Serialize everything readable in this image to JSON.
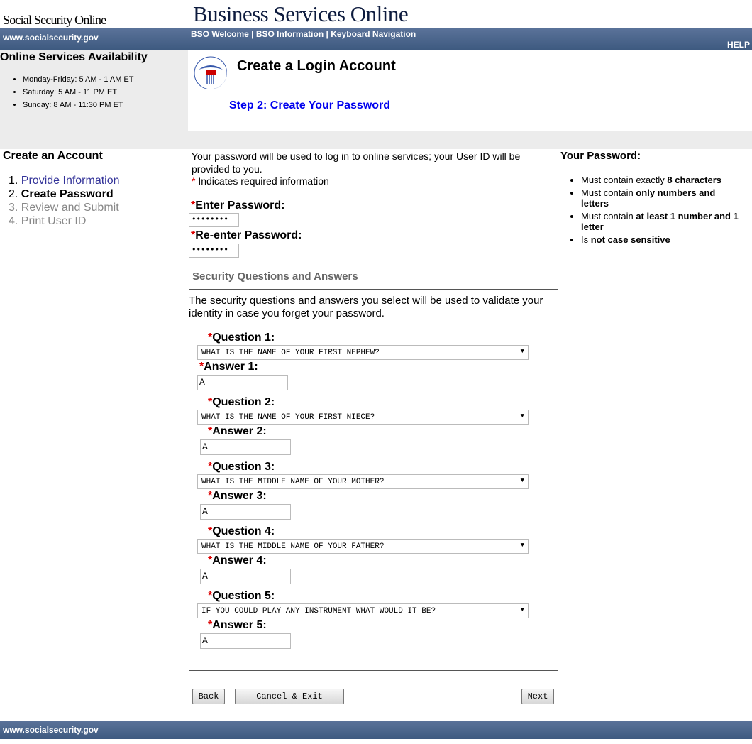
{
  "header": {
    "site_name": "Social Security Online",
    "app_title": "Business Services Online",
    "site_url": "www.socialsecurity.gov",
    "nav": [
      "BSO Welcome",
      "BSO Information",
      "Keyboard Navigation"
    ],
    "help": "HELP"
  },
  "availability": {
    "title": "Online Services Availability",
    "items": [
      "Monday-Friday: 5 AM - 1 AM ET",
      "Saturday: 5 AM - 11 PM ET",
      "Sunday: 8 AM - 11:30 PM ET"
    ]
  },
  "page": {
    "title": "Create a Login Account",
    "step": "Step 2: Create Your Password",
    "seal_text": "SOCIAL SECURITY ADMINISTRATION USA"
  },
  "sidebar": {
    "title": "Create an Account",
    "steps": [
      {
        "num": "1.",
        "label": "Provide Information"
      },
      {
        "num": "2.",
        "label": "Create Password"
      },
      {
        "num": "3.",
        "label": "Review and Submit"
      },
      {
        "num": "4.",
        "label": "Print User ID"
      }
    ]
  },
  "main": {
    "intro": "Your password will be used to log in to online services; your User ID will be provided to you.",
    "required_note": "Indicates required information",
    "required_mark": "*",
    "password_label": "Enter Password:",
    "password_value": "••••••••",
    "reenter_label": "Re-enter Password:",
    "reenter_value": "••••••••",
    "security_heading": "Security Questions and Answers",
    "security_intro": "The security questions and answers you select will be used to validate your identity in case you forget your password.",
    "questions": [
      {
        "q_label": "Question 1:",
        "q_value": "WHAT IS THE NAME OF YOUR FIRST NEPHEW?",
        "a_label": "Answer 1:",
        "a_value": "A"
      },
      {
        "q_label": "Question 2:",
        "q_value": "WHAT IS THE NAME OF YOUR FIRST NIECE?",
        "a_label": "Answer 2:",
        "a_value": "A"
      },
      {
        "q_label": "Question 3:",
        "q_value": "WHAT IS THE MIDDLE NAME OF YOUR MOTHER?",
        "a_label": "Answer 3:",
        "a_value": "A"
      },
      {
        "q_label": "Question 4:",
        "q_value": "WHAT IS THE MIDDLE NAME OF YOUR FATHER?",
        "a_label": "Answer 4:",
        "a_value": "A"
      },
      {
        "q_label": "Question 5:",
        "q_value": "IF YOU COULD PLAY ANY INSTRUMENT WHAT WOULD IT BE?",
        "a_label": "Answer 5:",
        "a_value": "A"
      }
    ],
    "buttons": {
      "back": "Back",
      "cancel": "Cancel & Exit",
      "next": "Next"
    }
  },
  "rules": {
    "title": "Your Password:",
    "items": [
      {
        "pre": "Must contain exactly ",
        "bold": "8 characters"
      },
      {
        "pre": "Must contain ",
        "bold": "only numbers and letters"
      },
      {
        "pre": "Must contain ",
        "bold": "at least 1 number and 1 letter"
      },
      {
        "pre": "Is ",
        "bold": "not case sensitive"
      }
    ]
  },
  "footer": {
    "site_url": "www.socialsecurity.gov"
  }
}
